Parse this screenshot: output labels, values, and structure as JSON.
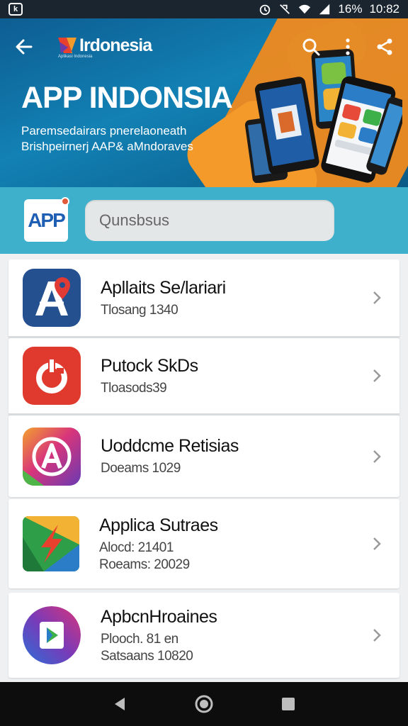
{
  "status_bar": {
    "app_icon": "k",
    "battery": "16%",
    "time": "10:82",
    "icons": [
      "alarm-icon",
      "vibrate-off-icon",
      "wifi-icon",
      "signal-icon"
    ]
  },
  "header": {
    "brand_name": "Irdonesia",
    "brand_tagline": "Aplikasi Indonesia",
    "title": "APP INDONSIA",
    "subtitle_line1": "Paremsedairars pnerelaoneath",
    "subtitle_line2": "Brishpeirnerj AAP& aMndoraves"
  },
  "search": {
    "badge": "APP",
    "placeholder": "Qunsbsus"
  },
  "apps": [
    {
      "title": "Apllaits Se/lariari",
      "sub": "Tlosang 1340"
    },
    {
      "title": "Putock SkDs",
      "sub": "Tloasods39"
    },
    {
      "title": "Uoddcme Retisias",
      "sub": "Doeams 1029"
    },
    {
      "title": "Applica Sutraes",
      "sub": "Alocd:   21401",
      "sub2": "Roeams: 20029"
    },
    {
      "title": "ApbcnHroaines",
      "sub": "Plooch.   81 en",
      "sub2": "Satsaans 10820"
    }
  ],
  "colors": {
    "header_blue": "#1281b4",
    "accent_orange": "#f08a1e",
    "search_strip": "#3fb0cc"
  }
}
